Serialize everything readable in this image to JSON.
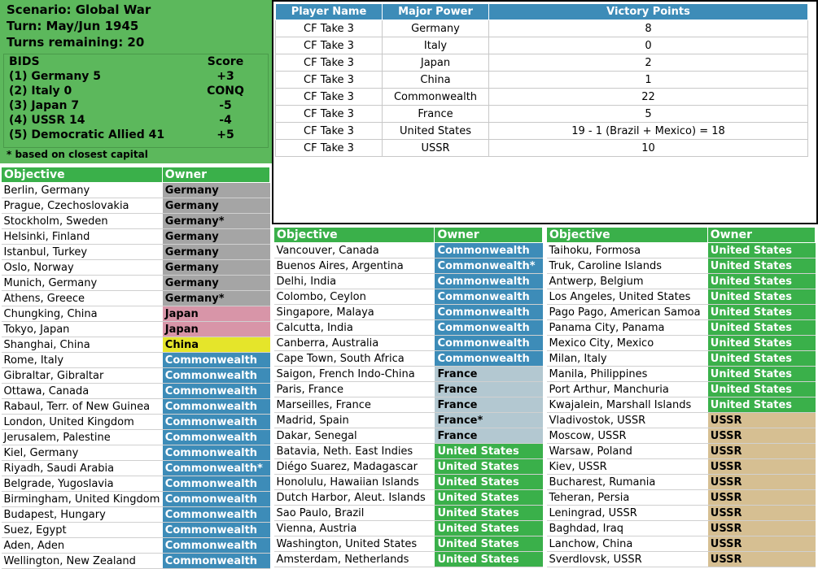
{
  "scenario": {
    "name": "Scenario: Global War",
    "turn": "Turn: May/Jun 1945",
    "turns_remaining": "Turns remaining: 20"
  },
  "bids": {
    "header": "BIDS",
    "score_header": "Score",
    "rows": [
      {
        "name": "(1) Germany 5",
        "score": "+3"
      },
      {
        "name": "(2) Italy 0",
        "score": "CONQ"
      },
      {
        "name": "(3) Japan 7",
        "score": "-5"
      },
      {
        "name": "(4) USSR 14",
        "score": "-4"
      },
      {
        "name": "(5) Democratic Allied 41",
        "score": "+5"
      }
    ],
    "footnote": "* based on closest capital"
  },
  "victory": {
    "headers": [
      "Player Name",
      "Major Power",
      "Victory Points"
    ],
    "rows": [
      [
        "CF Take 3",
        "Germany",
        "8"
      ],
      [
        "CF Take 3",
        "Italy",
        "0"
      ],
      [
        "CF Take 3",
        "Japan",
        "2"
      ],
      [
        "CF Take 3",
        "China",
        "1"
      ],
      [
        "CF Take 3",
        "Commonwealth",
        "22"
      ],
      [
        "CF Take 3",
        "France",
        "5"
      ],
      [
        "CF Take 3",
        "United States",
        "19 - 1 (Brazil + Mexico) = 18"
      ],
      [
        "CF Take 3",
        "USSR",
        "10"
      ]
    ]
  },
  "objectives_headers": [
    "Objective",
    "Owner"
  ],
  "objectives_left": [
    [
      "Berlin, Germany",
      "Germany",
      "Germany"
    ],
    [
      "Prague, Czechoslovakia",
      "Germany",
      "Germany"
    ],
    [
      "Stockholm, Sweden",
      "Germany*",
      "Germany"
    ],
    [
      "Helsinki, Finland",
      "Germany",
      "Germany"
    ],
    [
      "Istanbul, Turkey",
      "Germany",
      "Germany"
    ],
    [
      "Oslo, Norway",
      "Germany",
      "Germany"
    ],
    [
      "Munich, Germany",
      "Germany",
      "Germany"
    ],
    [
      "Athens, Greece",
      "Germany*",
      "Germany"
    ],
    [
      "Chungking, China",
      "Japan",
      "Japan"
    ],
    [
      "Tokyo, Japan",
      "Japan",
      "Japan"
    ],
    [
      "Shanghai, China",
      "China",
      "China"
    ],
    [
      "Rome, Italy",
      "Commonwealth",
      "Commonwealth"
    ],
    [
      "Gibraltar, Gibraltar",
      "Commonwealth",
      "Commonwealth"
    ],
    [
      "Ottawa, Canada",
      "Commonwealth",
      "Commonwealth"
    ],
    [
      "Rabaul, Terr. of New Guinea",
      "Commonwealth",
      "Commonwealth"
    ],
    [
      "London, United Kingdom",
      "Commonwealth",
      "Commonwealth"
    ],
    [
      "Jerusalem, Palestine",
      "Commonwealth",
      "Commonwealth"
    ],
    [
      "Kiel, Germany",
      "Commonwealth",
      "Commonwealth"
    ],
    [
      "Riyadh, Saudi Arabia",
      "Commonwealth*",
      "Commonwealth"
    ],
    [
      "Belgrade, Yugoslavia",
      "Commonwealth",
      "Commonwealth"
    ],
    [
      "Birmingham, United Kingdom",
      "Commonwealth",
      "Commonwealth"
    ],
    [
      "Budapest, Hungary",
      "Commonwealth",
      "Commonwealth"
    ],
    [
      "Suez, Egypt",
      "Commonwealth",
      "Commonwealth"
    ],
    [
      "Aden, Aden",
      "Commonwealth",
      "Commonwealth"
    ],
    [
      "Wellington, New Zealand",
      "Commonwealth",
      "Commonwealth"
    ]
  ],
  "objectives_middle": [
    [
      "Vancouver, Canada",
      "Commonwealth",
      "Commonwealth"
    ],
    [
      "Buenos Aires, Argentina",
      "Commonwealth*",
      "Commonwealth"
    ],
    [
      "Delhi, India",
      "Commonwealth",
      "Commonwealth"
    ],
    [
      "Colombo, Ceylon",
      "Commonwealth",
      "Commonwealth"
    ],
    [
      "Singapore, Malaya",
      "Commonwealth",
      "Commonwealth"
    ],
    [
      "Calcutta, India",
      "Commonwealth",
      "Commonwealth"
    ],
    [
      "Canberra, Australia",
      "Commonwealth",
      "Commonwealth"
    ],
    [
      "Cape Town, South Africa",
      "Commonwealth",
      "Commonwealth"
    ],
    [
      "Saigon, French Indo-China",
      "France",
      "France"
    ],
    [
      "Paris, France",
      "France",
      "France"
    ],
    [
      "Marseilles, France",
      "France",
      "France"
    ],
    [
      "Madrid, Spain",
      "France*",
      "France"
    ],
    [
      "Dakar, Senegal",
      "France",
      "France"
    ],
    [
      "Batavia, Neth. East Indies",
      "United States",
      "US"
    ],
    [
      "Diégo Suarez, Madagascar",
      "United States",
      "US"
    ],
    [
      "Honolulu, Hawaiian Islands",
      "United States",
      "US"
    ],
    [
      "Dutch Harbor, Aleut. Islands",
      "United States",
      "US"
    ],
    [
      "Sao Paulo, Brazil",
      "United States",
      "US"
    ],
    [
      "Vienna, Austria",
      "United States",
      "US"
    ],
    [
      "Washington, United States",
      "United States",
      "US"
    ],
    [
      "Amsterdam, Netherlands",
      "United States",
      "US"
    ]
  ],
  "objectives_right": [
    [
      "Taihoku, Formosa",
      "United States",
      "US"
    ],
    [
      "Truk, Caroline Islands",
      "United States",
      "US"
    ],
    [
      "Antwerp, Belgium",
      "United States",
      "US"
    ],
    [
      "Los Angeles, United States",
      "United States",
      "US"
    ],
    [
      "Pago Pago, American Samoa",
      "United States",
      "US"
    ],
    [
      "Panama City, Panama",
      "United States",
      "US"
    ],
    [
      "Mexico City, Mexico",
      "United States",
      "US"
    ],
    [
      "Milan, Italy",
      "United States",
      "US"
    ],
    [
      "Manila, Philippines",
      "United States",
      "US"
    ],
    [
      "Port Arthur, Manchuria",
      "United States",
      "US"
    ],
    [
      "Kwajalein, Marshall Islands",
      "United States",
      "US"
    ],
    [
      "Vladivostok, USSR",
      "USSR",
      "USSR"
    ],
    [
      "Moscow, USSR",
      "USSR",
      "USSR"
    ],
    [
      "Warsaw, Poland",
      "USSR",
      "USSR"
    ],
    [
      "Kiev, USSR",
      "USSR",
      "USSR"
    ],
    [
      "Bucharest, Rumania",
      "USSR",
      "USSR"
    ],
    [
      "Teheran, Persia",
      "USSR",
      "USSR"
    ],
    [
      "Leningrad, USSR",
      "USSR",
      "USSR"
    ],
    [
      "Baghdad, Iraq",
      "USSR",
      "USSR"
    ],
    [
      "Lanchow, China",
      "USSR",
      "USSR"
    ],
    [
      "Sverdlovsk, USSR",
      "USSR",
      "USSR"
    ]
  ]
}
